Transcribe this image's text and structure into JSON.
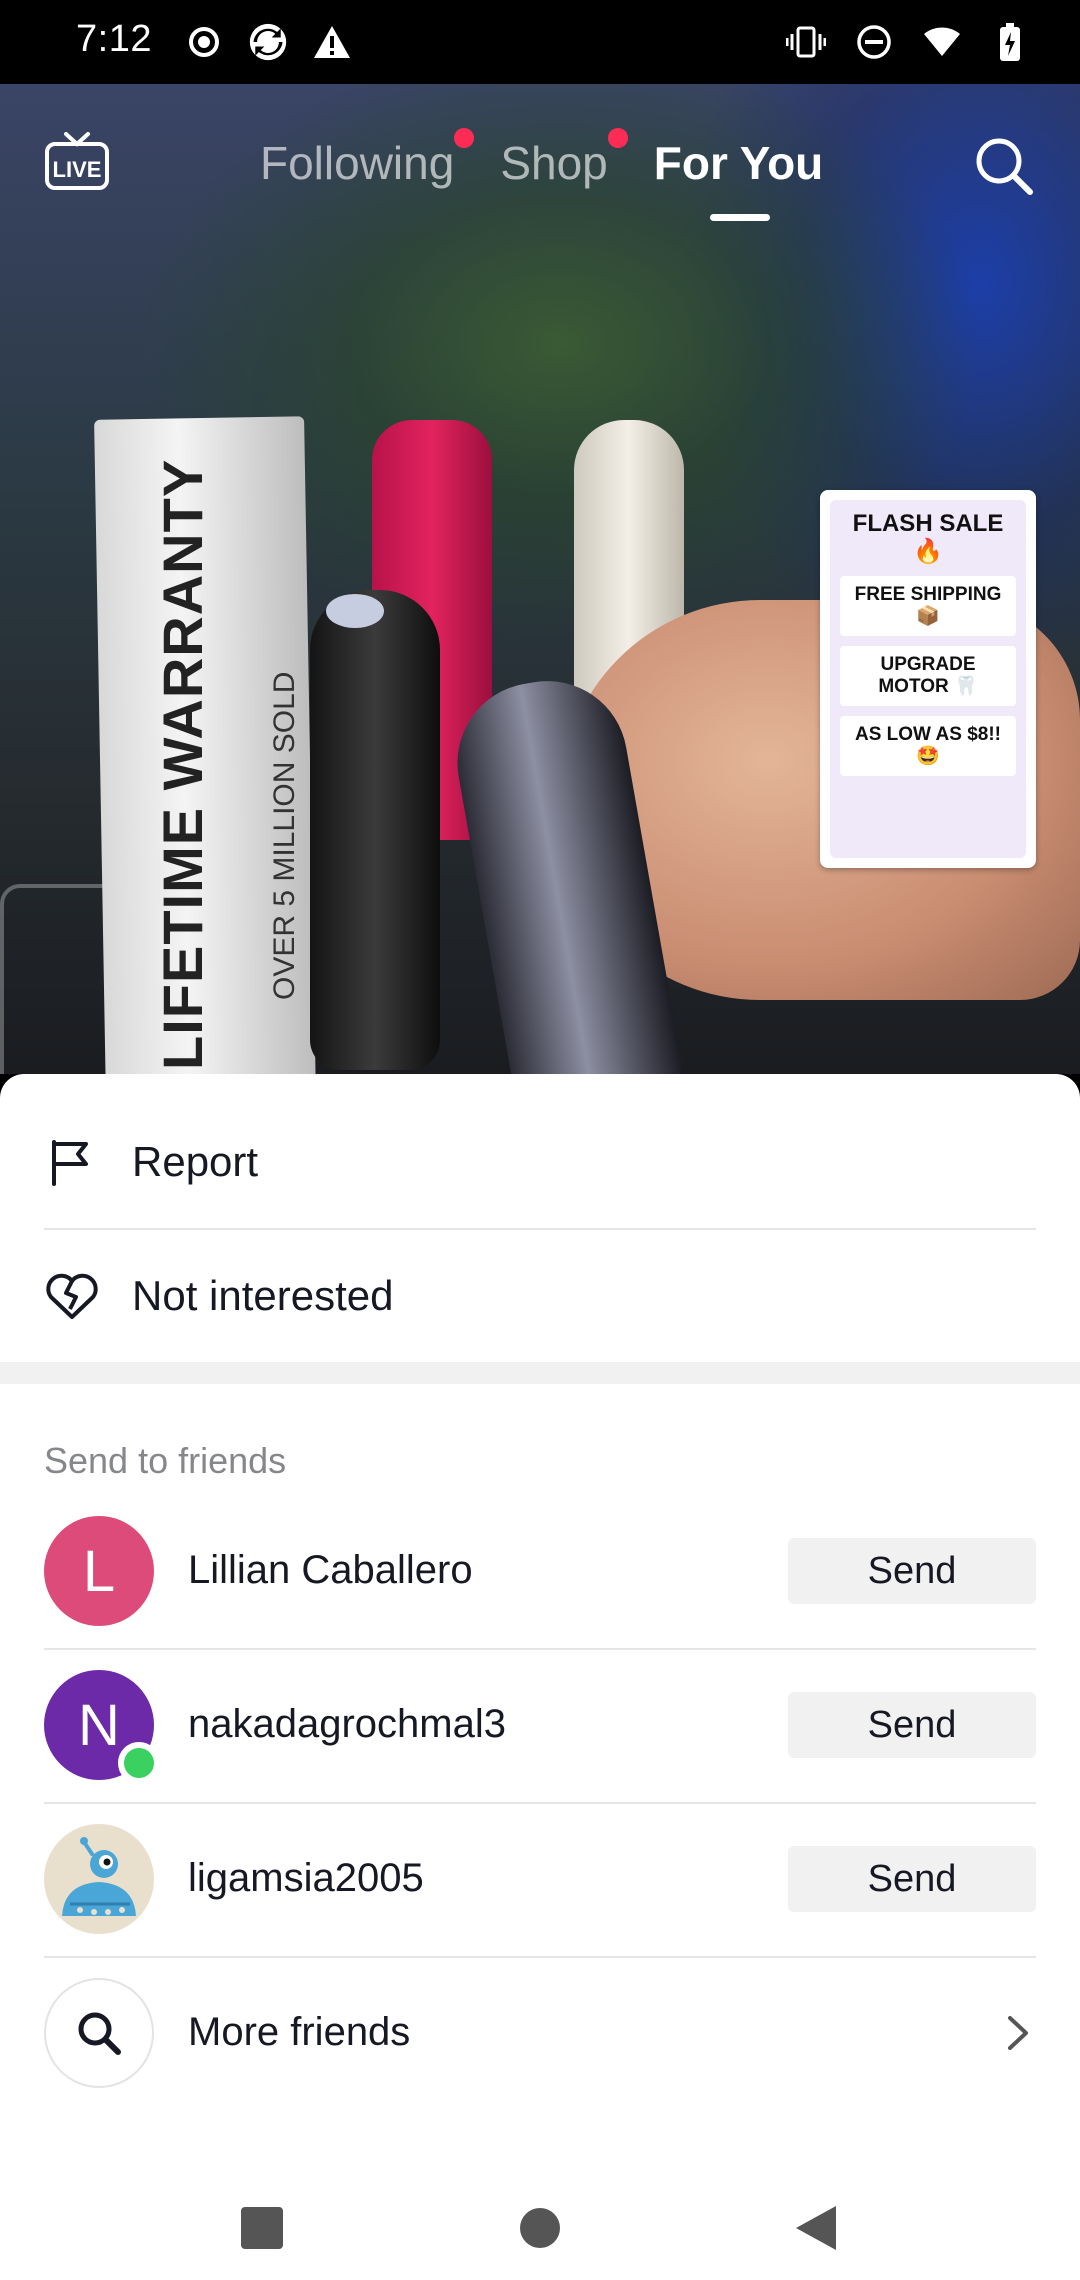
{
  "status_bar": {
    "time": "7:12",
    "left_icons": [
      "target-icon",
      "sync-app-icon",
      "warning-icon"
    ],
    "right_icons": [
      "vibrate-icon",
      "do-not-disturb-icon",
      "wifi-icon",
      "battery-charging-icon"
    ]
  },
  "top_nav": {
    "live_label": "LIVE",
    "tabs": [
      {
        "label": "Following",
        "has_dot": true,
        "active": false
      },
      {
        "label": "Shop",
        "has_dot": true,
        "active": false
      },
      {
        "label": "For You",
        "has_dot": false,
        "active": true
      }
    ]
  },
  "video": {
    "box_text": "LIFETIME WARRANTY",
    "box_subtext": "OVER 5 MILLION SOLD",
    "promo": {
      "title": "FLASH SALE 🔥",
      "items": [
        "FREE SHIPPING 📦",
        "UPGRADE MOTOR 🦷",
        "AS LOW AS $8!! 🤩"
      ]
    }
  },
  "sheet": {
    "actions": [
      {
        "label": "Report",
        "icon": "flag-icon"
      },
      {
        "label": "Not interested",
        "icon": "broken-heart-icon"
      }
    ],
    "section_title": "Send to friends",
    "friends": [
      {
        "name": "Lillian Caballero",
        "initial": "L",
        "avatar_color": "#dd4b7a",
        "online": false,
        "button": "Send"
      },
      {
        "name": "nakadagrochmal3",
        "initial": "N",
        "avatar_color": "#6c2aa8",
        "online": true,
        "button": "Send"
      },
      {
        "name": "ligamsia2005",
        "initial": "",
        "avatar_color": "#e9dfcd",
        "online": false,
        "button": "Send"
      }
    ],
    "more": {
      "label": "More friends",
      "icon": "search-icon"
    }
  },
  "nav_bar": {
    "buttons": [
      "recents-button",
      "home-button",
      "back-button"
    ]
  },
  "colors": {
    "accent": "#fe2c55",
    "online": "#3ad160",
    "button_bg": "#f1f1f2",
    "text": "#161823",
    "muted": "#86878b"
  }
}
